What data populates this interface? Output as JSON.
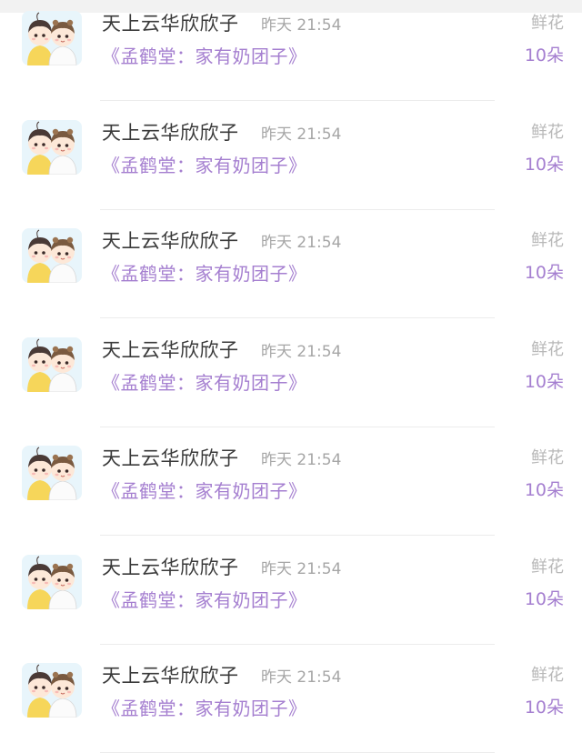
{
  "gift_list": {
    "items": [
      {
        "user_name": "天上云华欣欣子",
        "time": "昨天 21:54",
        "book_title": "《孟鹤堂：家有奶团子》",
        "gift_type": "鲜花",
        "gift_count": "10朵"
      },
      {
        "user_name": "天上云华欣欣子",
        "time": "昨天 21:54",
        "book_title": "《孟鹤堂：家有奶团子》",
        "gift_type": "鲜花",
        "gift_count": "10朵"
      },
      {
        "user_name": "天上云华欣欣子",
        "time": "昨天 21:54",
        "book_title": "《孟鹤堂：家有奶团子》",
        "gift_type": "鲜花",
        "gift_count": "10朵"
      },
      {
        "user_name": "天上云华欣欣子",
        "time": "昨天 21:54",
        "book_title": "《孟鹤堂：家有奶团子》",
        "gift_type": "鲜花",
        "gift_count": "10朵"
      },
      {
        "user_name": "天上云华欣欣子",
        "time": "昨天 21:54",
        "book_title": "《孟鹤堂：家有奶团子》",
        "gift_type": "鲜花",
        "gift_count": "10朵"
      },
      {
        "user_name": "天上云华欣欣子",
        "time": "昨天 21:54",
        "book_title": "《孟鹤堂：家有奶团子》",
        "gift_type": "鲜花",
        "gift_count": "10朵"
      },
      {
        "user_name": "天上云华欣欣子",
        "time": "昨天 21:54",
        "book_title": "《孟鹤堂：家有奶团子》",
        "gift_type": "鲜花",
        "gift_count": "10朵"
      }
    ]
  },
  "colors": {
    "name": "#3a3a3a",
    "time": "#a6a6a6",
    "accent": "#a57fd0",
    "gift_type": "#b8b8b8",
    "divider": "#ececec"
  }
}
